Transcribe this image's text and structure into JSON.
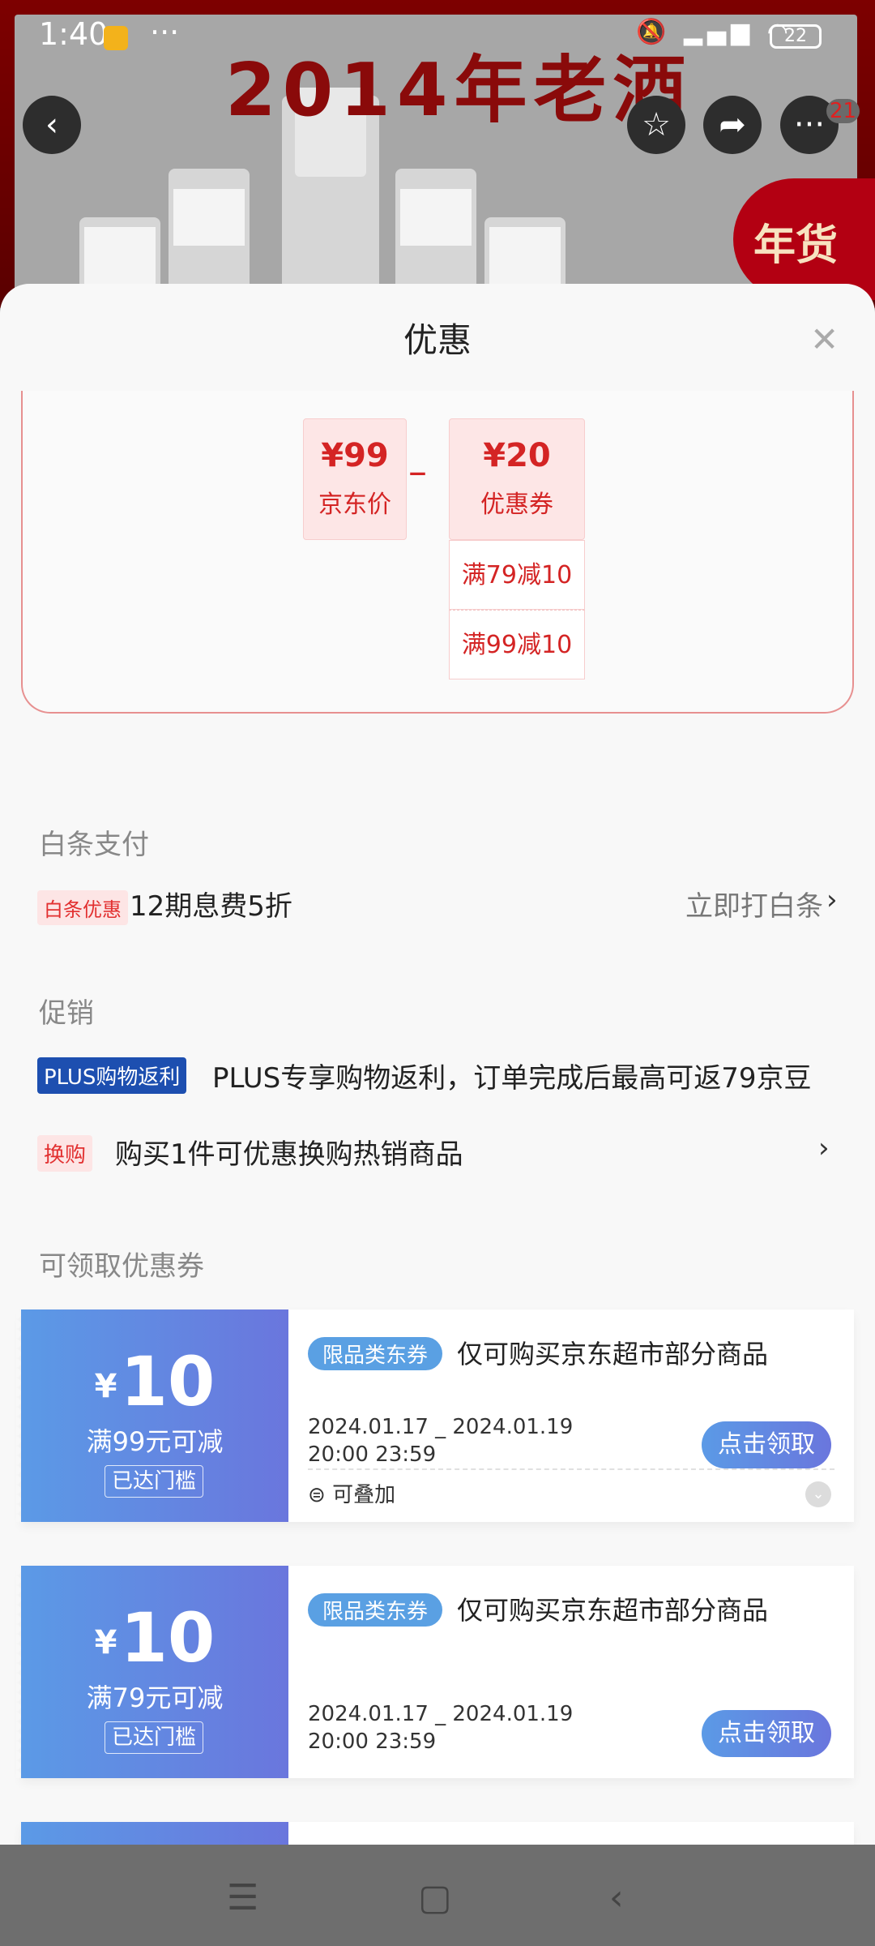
{
  "status": {
    "time": "1:40",
    "more": "···",
    "icons": "HD 📶 📡",
    "battery": "22"
  },
  "hero": {
    "title": "2014年老酒",
    "badge": "年货节",
    "notification_count": "21"
  },
  "sheet": {
    "title": "优惠",
    "calc": {
      "price_value": "¥99",
      "price_label": "京东价",
      "minus": "–",
      "coupon_value": "¥20",
      "coupon_label": "优惠券",
      "rules": [
        "满79减10",
        "满99减10"
      ]
    },
    "baitiao": {
      "heading": "白条支付",
      "chip": "白条优惠",
      "text": "12期息费5折",
      "action": "立即打白条",
      "chevron": "›"
    },
    "promo": {
      "heading": "促销",
      "plus_chip": "PLUS购物返利",
      "plus_text": "PLUS专享购物返利，订单完成后最高可返79京豆",
      "swap_chip": "换购",
      "swap_text": "购买1件可优惠换购热销商品",
      "chevron": "›"
    },
    "coupons": {
      "heading": "可领取优惠券",
      "items": [
        {
          "currency": "¥",
          "amount": "10",
          "condition": "满99元可减",
          "met": "已达门槛",
          "tag": "限品类东券",
          "desc": "仅可购买京东超市部分商品",
          "date1": "2024.01.17 _ 2024.01.19",
          "date2": "20:00 23:59",
          "button": "点击领取",
          "stack": "可叠加"
        },
        {
          "currency": "¥",
          "amount": "10",
          "condition": "满79元可减",
          "met": "已达门槛",
          "tag": "限品类东券",
          "desc": "仅可购买京东超市部分商品",
          "date1": "2024.01.17 _ 2024.01.19",
          "date2": "20:00 23:59",
          "button": "点击领取"
        }
      ]
    }
  },
  "colors": {
    "accent_red": "#d42424",
    "coupon_blue": "#5b9ae6",
    "coupon_purple": "#6a76dd"
  }
}
